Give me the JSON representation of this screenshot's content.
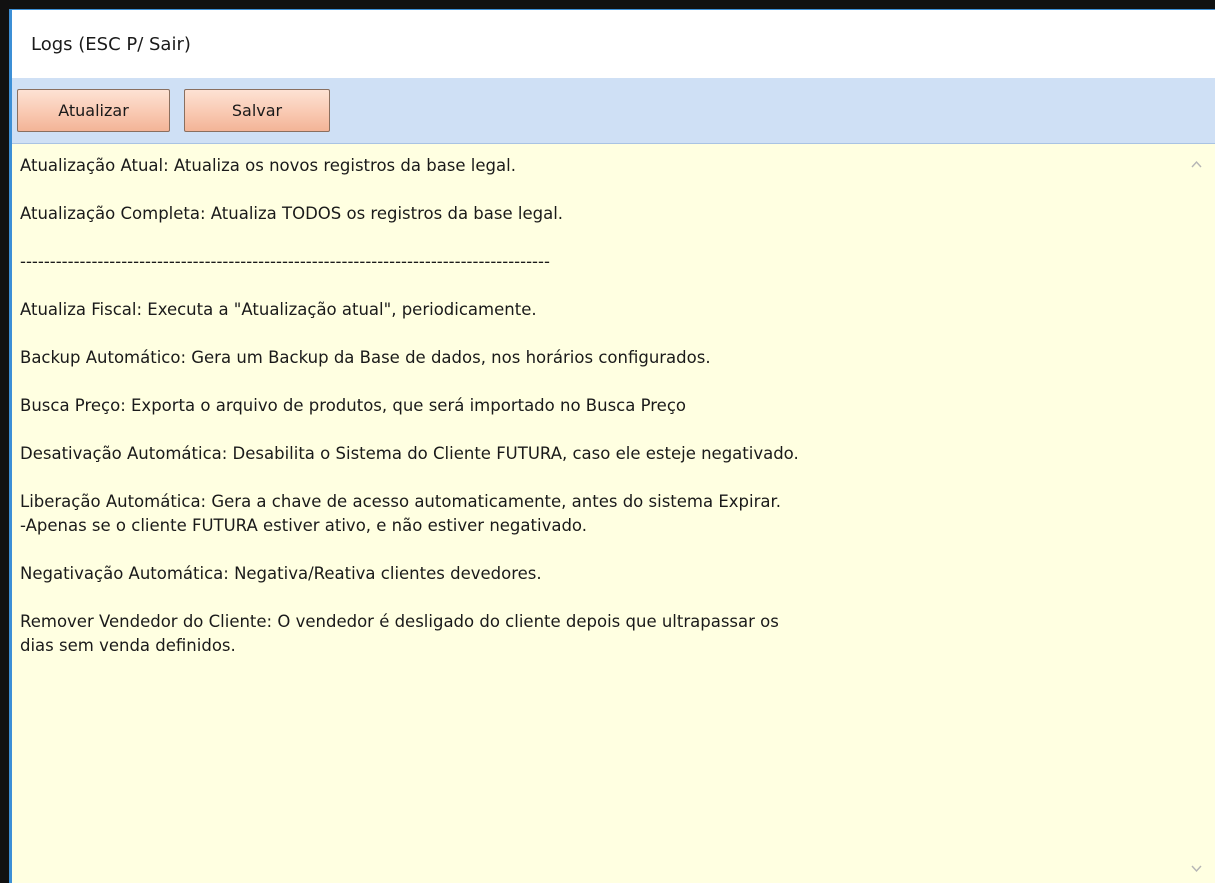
{
  "window": {
    "title": "Logs (ESC P/ Sair)"
  },
  "toolbar": {
    "update_label": "Atualizar",
    "save_label": "Salvar"
  },
  "log": {
    "paragraphs": [
      "Atualização Atual: Atualiza os novos registros da base legal.",
      "Atualização Completa: Atualiza TODOS os registros da base legal.",
      "-----------------------------------------------------------------------------------------",
      "Atualiza Fiscal: Executa a \"Atualização atual\", periodicamente.",
      "Backup Automático: Gera um Backup da Base de dados, nos horários configurados.",
      "Busca Preço: Exporta o arquivo de produtos, que será importado no Busca Preço",
      "Desativação Automática: Desabilita o Sistema do Cliente FUTURA, caso ele esteje negativado.",
      "Liberação Automática: Gera a chave de acesso automaticamente, antes do sistema Expirar.\n-Apenas se o cliente FUTURA estiver ativo, e não estiver negativado.",
      "Negativação Automática: Negativa/Reativa clientes devedores.",
      "Remover Vendedor do Cliente: O vendedor é desligado do cliente depois que ultrapassar os\ndias sem venda definidos."
    ]
  },
  "colors": {
    "toolbar_bg": "#cfe0f5",
    "content_bg": "#ffffe1",
    "button_bg": "#f9c9b2",
    "frame_accent": "#3c8fd6"
  },
  "icons": {
    "scroll_up": "chevron-up-icon",
    "scroll_down": "chevron-down-icon"
  }
}
